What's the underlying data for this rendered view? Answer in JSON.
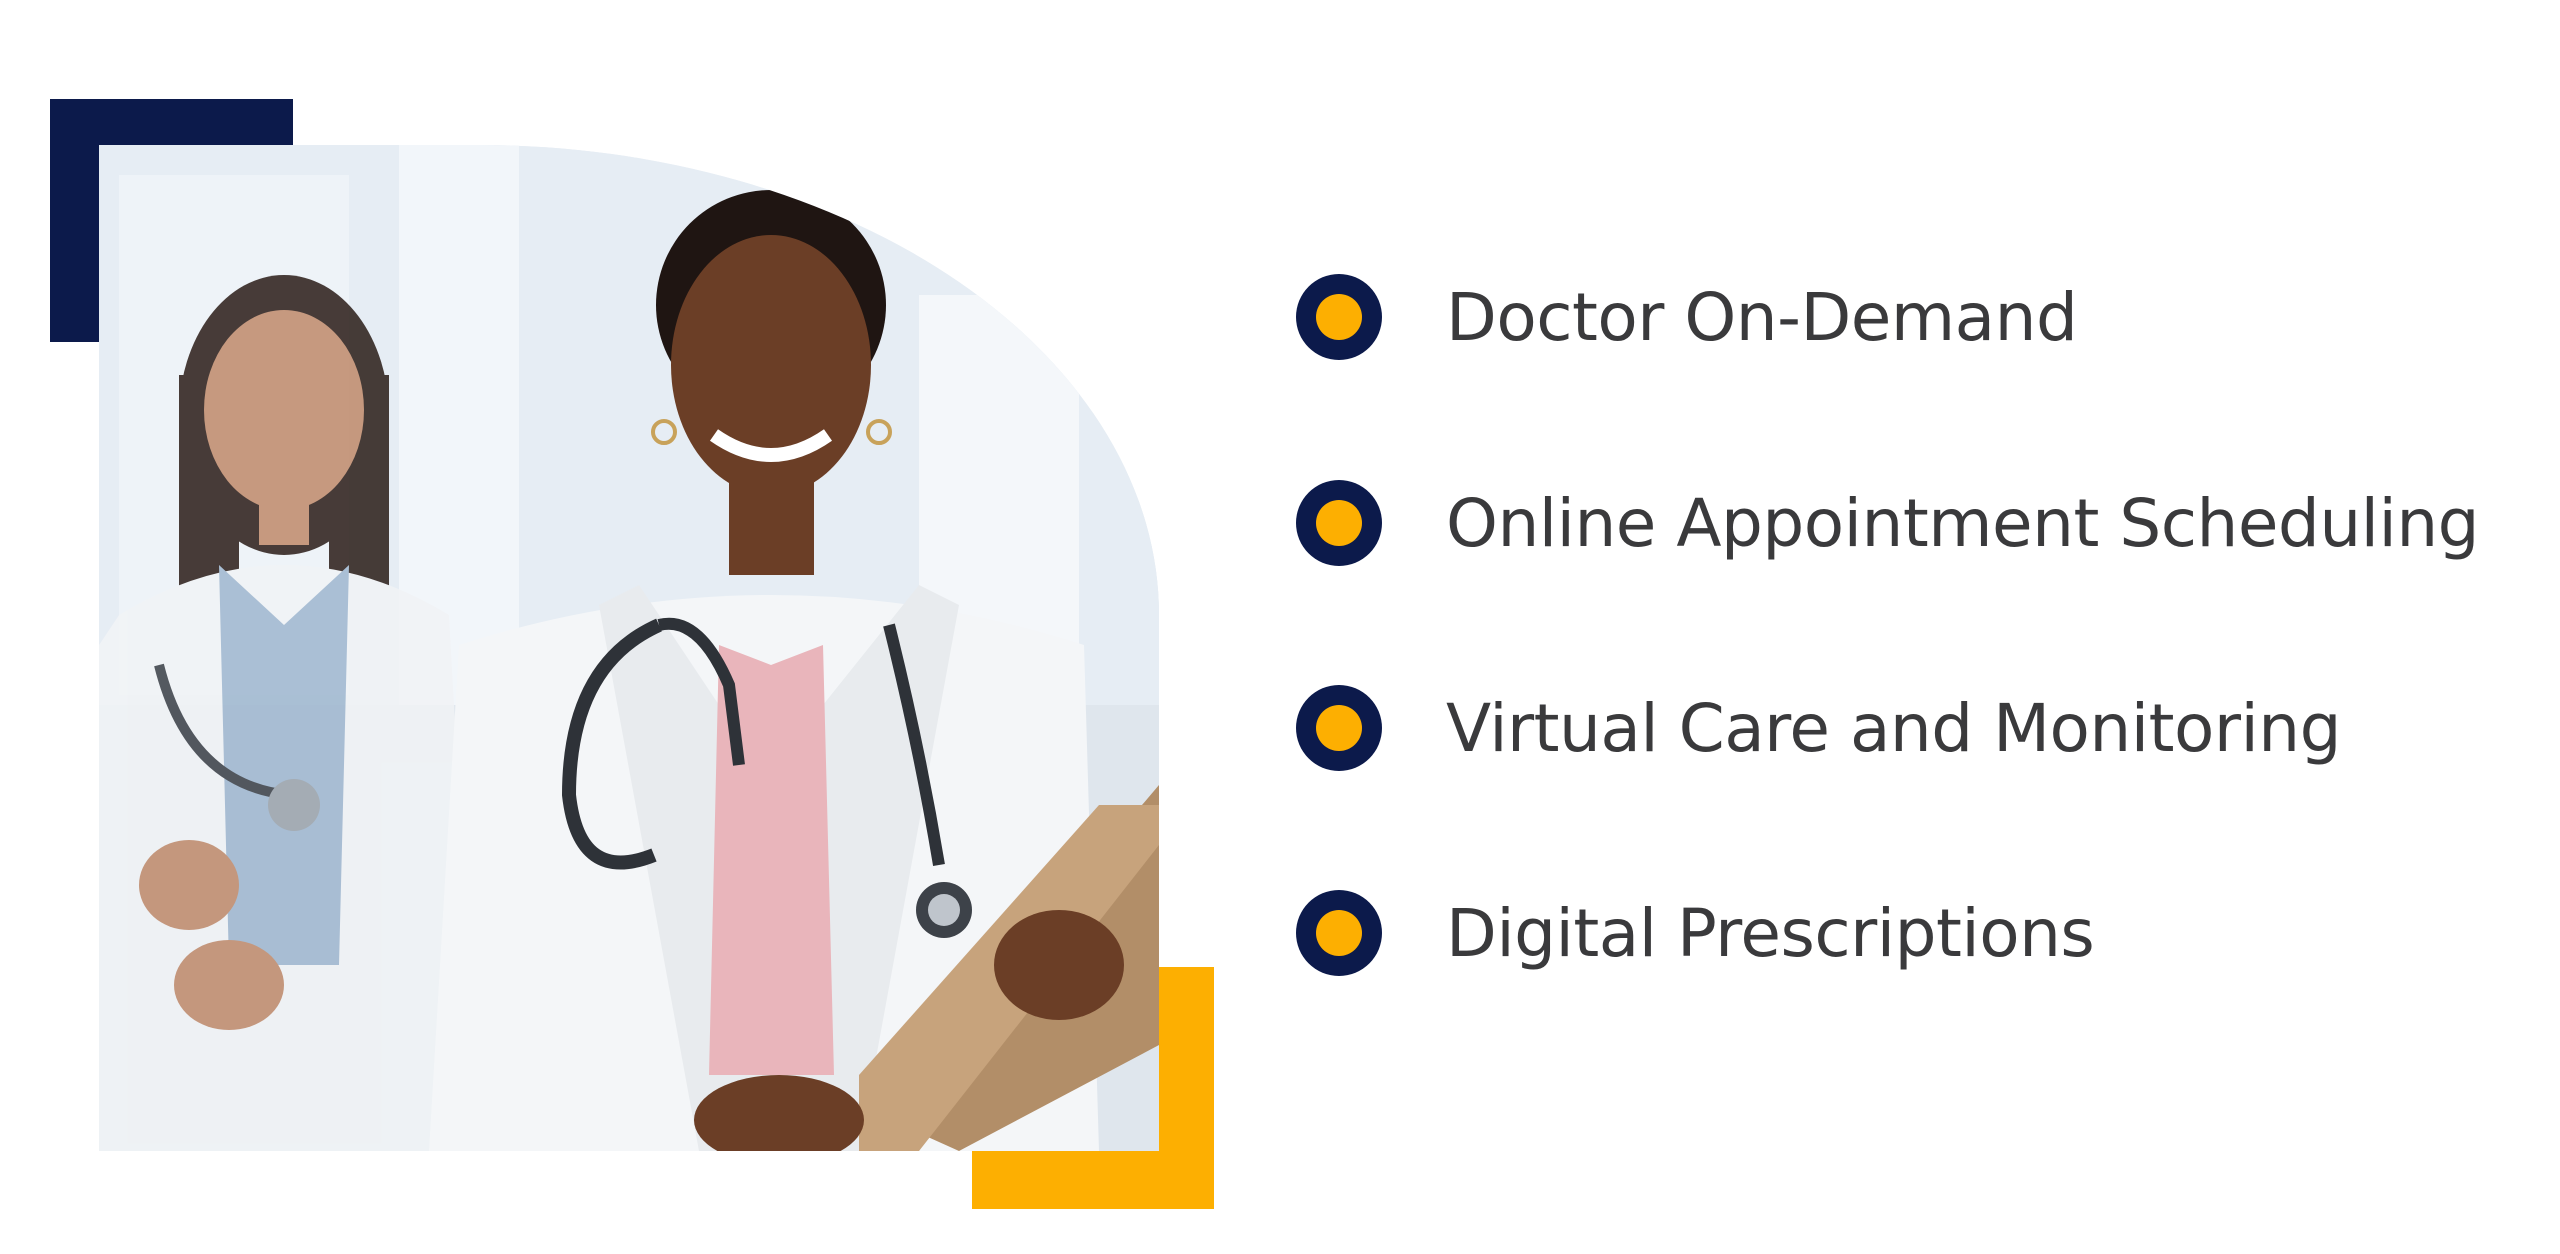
{
  "features": [
    {
      "label": "Doctor On-Demand"
    },
    {
      "label": "Online Appointment Scheduling"
    },
    {
      "label": "Virtual Care and Monitoring"
    },
    {
      "label": "Digital Prescriptions"
    }
  ],
  "colors": {
    "navy": "#0c1a4b",
    "gold": "#fdaf01",
    "text": "#3a3a3c"
  },
  "photo": {
    "icon": "doctors-photo"
  }
}
